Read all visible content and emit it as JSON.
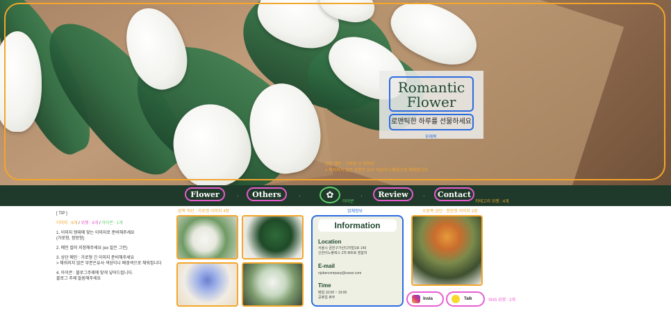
{
  "hero": {
    "title_line1": "Romantic",
    "title_line2": "Flower",
    "subtitle": "로맨틱한 하루를 선물하세요",
    "title_tag": "제목",
    "subtitle_tag": "부제목",
    "note_line1": "상단 메인 : 가로형 긴 이미지",
    "note_line2": "> 채워지지 않은 부분은 유사 색상이나 배경으로 채워집니다"
  },
  "nav": {
    "items": [
      "Flower",
      "Others",
      "Review",
      "Contact"
    ],
    "logo_label": "아이콘",
    "category_note": "카테고리 위젯 : 4개"
  },
  "tips": {
    "title": "[ TIP ]",
    "counts_images": "이미지 : 6개",
    "counts_widgets": "위젯 : 6개",
    "counts_icons": "아이콘 : 1개",
    "sep": " / ",
    "tip1_line1": "1. 이미지 형태에 맞는 이미지로 준비해주세요",
    "tip1_line2": "(가로형, 정방형)",
    "tip2": "2. 메인 컬러 지정해주세요 (ex 짙은 그린)",
    "tip3_line1": "3. 상단 메인 : 가로형 긴 이미지 준비해주세요",
    "tip3_line2": "> 채워지지 않은 부분은유사 색상이나 배경색으로 채워집니다",
    "tip4_line1": "4. 아이콘 : 블로그주제에 맞게 넣어드립니다.",
    "tip4_line2": "블로그 주제 말씀해주세요"
  },
  "grid": {
    "label": "왼쪽 하단 : 가로형 이미지 4장"
  },
  "info": {
    "label": "업체정보",
    "title": "Information",
    "location_h": "Location",
    "location_line1": "서울시 금천구가산디지털1로 149",
    "location_line2": "신한이노플렉스 2차 805호 엔잡러",
    "email_h": "E-mail",
    "email": "njobercompany@naver.com",
    "time_h": "Time",
    "time_line1": "매일 10:00 ~ 19:00",
    "time_line2": "공휴일 휴무"
  },
  "right": {
    "label": "오른쪽 상단 : 정방형 이미지 1장",
    "sns_label": "SNS 위젯 : 2개",
    "insta": "Insta",
    "talk": "Talk"
  },
  "colors": {
    "main_green": "#1f3a2a",
    "orange": "#f4a62a",
    "pink": "#e85bcf",
    "blue": "#2b6be0",
    "green": "#62d06a"
  }
}
